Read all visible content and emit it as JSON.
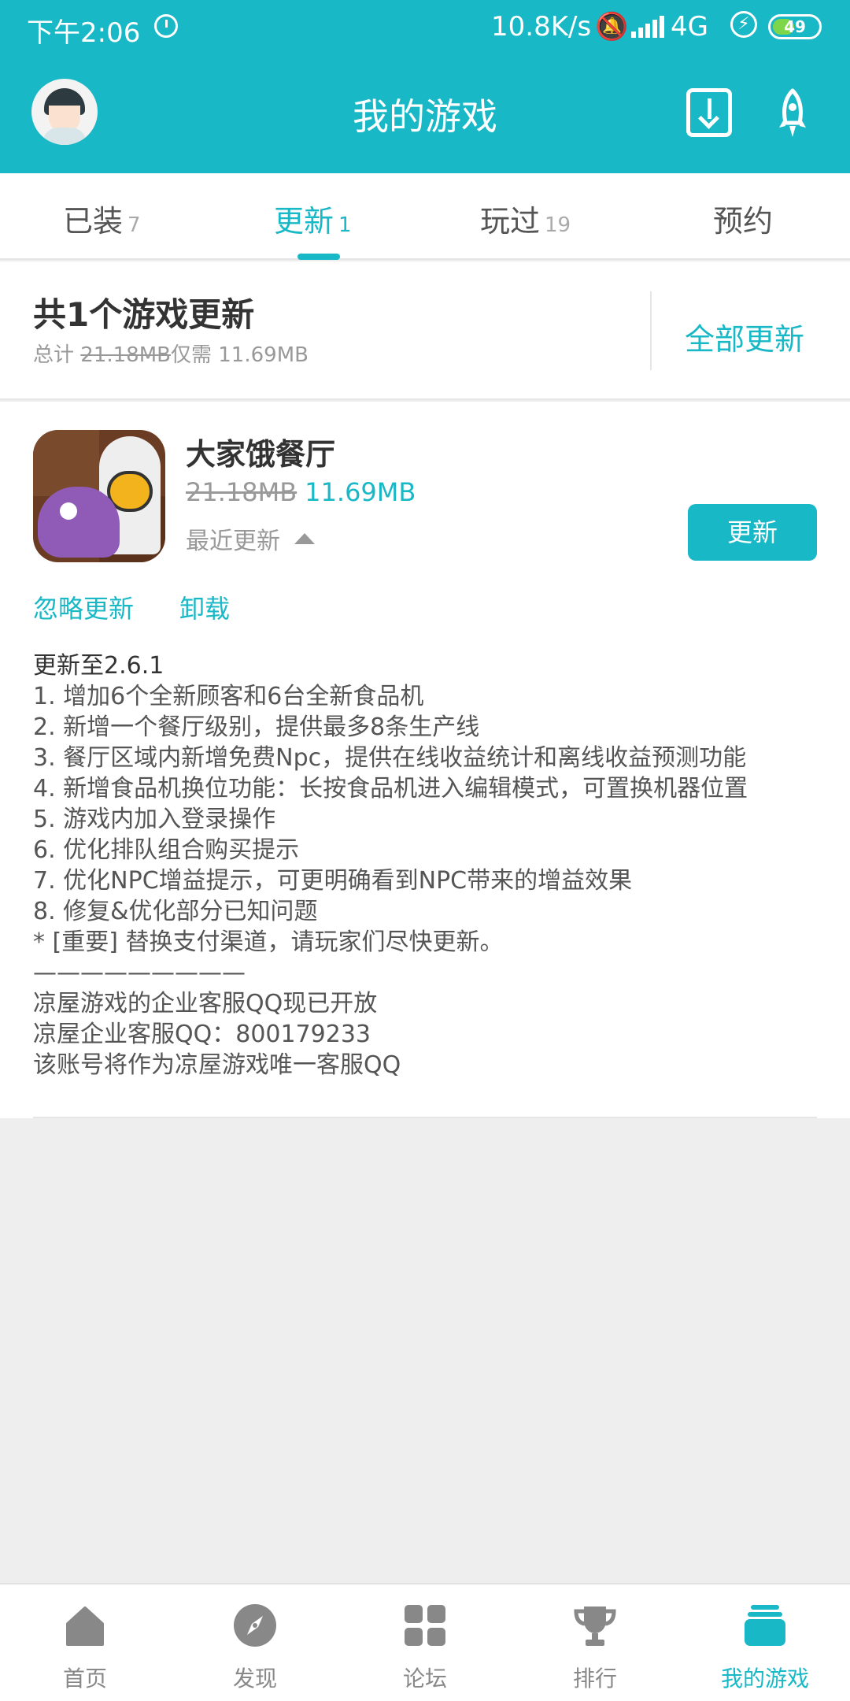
{
  "status_bar": {
    "time": "下午2:06",
    "net_speed": "10.8K/s",
    "network": "4G",
    "battery": "49",
    "battery_level": 0.49,
    "battery_color": "#7dd64a"
  },
  "header": {
    "title": "我的游戏",
    "icons": [
      "avatar",
      "download-icon",
      "rocket-icon"
    ]
  },
  "tabs": [
    {
      "label": "已装",
      "count": "7"
    },
    {
      "label": "更新",
      "count": "1"
    },
    {
      "label": "玩过",
      "count": "19"
    },
    {
      "label": "预约",
      "count": ""
    }
  ],
  "active_tab": "更新",
  "summary": {
    "title": "共1个游戏更新",
    "total_label": "总计",
    "total_size": "21.18MB",
    "need_label": "仅需",
    "need_size": "11.69MB",
    "update_all": "全部更新"
  },
  "game": {
    "name": "大家饿餐厅",
    "old_size": "21.18MB",
    "new_size": "11.69MB",
    "recent_label": "最近更新",
    "update_button": "更新",
    "ignore_link": "忽略更新",
    "uninstall_link": "卸载",
    "notes": [
      "更新至2.6.1",
      "1. 增加6个全新顾客和6台全新食品机",
      "2. 新增一个餐厅级别，提供最多8条生产线",
      "3. 餐厅区域内新增免费Npc，提供在线收益统计和离线收益预测功能",
      "4. 新增食品机换位功能：长按食品机进入编辑模式，可置换机器位置",
      "5. 游戏内加入登录操作",
      "6. 优化排队组合购买提示",
      "7. 优化NPC增益提示，可更明确看到NPC带来的增益效果",
      "8. 修复&优化部分已知问题",
      "* [重要] 替换支付渠道，请玩家们尽快更新。",
      "—————————",
      "凉屋游戏的企业客服QQ现已开放",
      "凉屋企业客服QQ：800179233",
      "该账号将作为凉屋游戏唯一客服QQ"
    ]
  },
  "bottom_nav": [
    {
      "label": "首页",
      "icon": "home-icon"
    },
    {
      "label": "发现",
      "icon": "compass-icon"
    },
    {
      "label": "论坛",
      "icon": "grid-icon"
    },
    {
      "label": "排行",
      "icon": "trophy-icon"
    },
    {
      "label": "我的游戏",
      "icon": "stack-icon"
    }
  ],
  "active_nav": "我的游戏",
  "colors": {
    "accent": "#19b8c6",
    "inactive": "#888888",
    "background": "#eeeeee"
  }
}
